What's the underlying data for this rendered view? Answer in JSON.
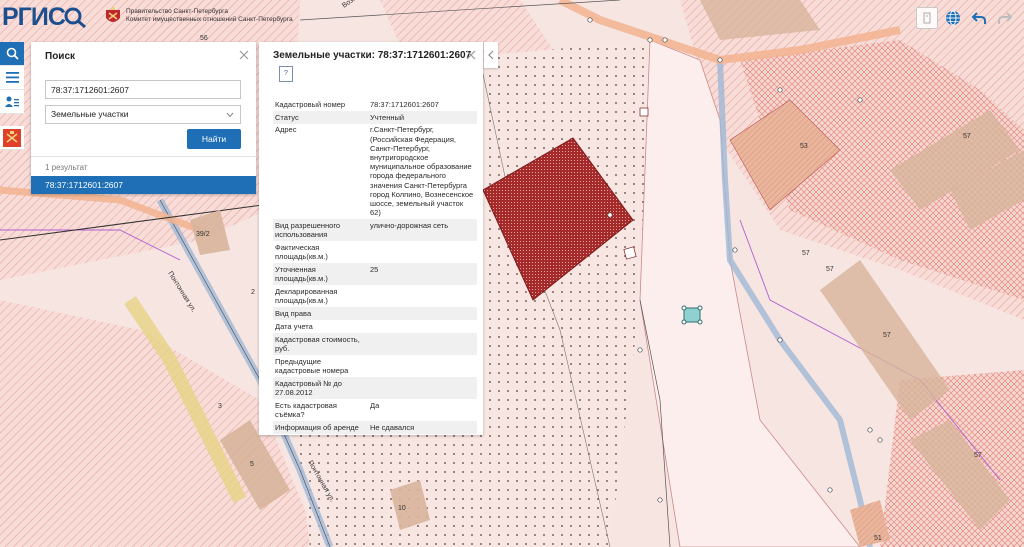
{
  "header": {
    "logo": "РГИС",
    "gov_line1": "Правительство Санкт-Петербурга",
    "gov_line2": "Комитет имущественных отношений Санкт-Петербурга"
  },
  "icons": {
    "search": "search-icon",
    "menu": "menu-icon",
    "user_list": "user-list-icon",
    "flag": "spb-flag-icon",
    "print": "print-icon",
    "globe": "globe-icon",
    "undo": "undo-icon",
    "redo": "redo-icon",
    "close": "close-icon",
    "chevron_left": "chevron-left-icon",
    "chevron_down": "chevron-down-icon"
  },
  "colors": {
    "accent": "#1e6fb5",
    "parcel": "#a52a2a",
    "map_bg": "#f6e4e1"
  },
  "search": {
    "title": "Поиск",
    "query": "78:37:1712601:2607",
    "type": "Земельные участки",
    "button": "Найти",
    "result_count": "1 результат",
    "results": [
      "78:37:1712601:2607"
    ]
  },
  "info": {
    "title": "Земельные участки: 78:37:1712601:2607",
    "help": "?",
    "rows": [
      {
        "key": "Кадастровый номер",
        "value": "78:37:1712601:2607"
      },
      {
        "key": "Статус",
        "value": "Учтенный"
      },
      {
        "key": "Адрес",
        "value": "г.Санкт-Петербург, (Российская Федерация, Санкт-Петербург, внутригородское муниципальное образование города федерального значения Санкт-Петербурга город Колпино, Вознесенское шоссе, земельный участок 62)"
      },
      {
        "key": "Вид разрешенного использования",
        "value": "улично-дорожная сеть"
      },
      {
        "key": "Фактическая площадь(кв.м.)",
        "value": ""
      },
      {
        "key": "Уточненная площадь(кв.м.)",
        "value": "25"
      },
      {
        "key": "Декларированная площадь(кв.м.)",
        "value": ""
      },
      {
        "key": "Вид права",
        "value": ""
      },
      {
        "key": "Дата учета",
        "value": ""
      },
      {
        "key": "Кадастровая стоимость, руб.",
        "value": ""
      },
      {
        "key": "Предыдущие кадастровые номера",
        "value": ""
      },
      {
        "key": "Кадастровый № до 27.08.2012",
        "value": ""
      },
      {
        "key": "Есть кадастровая съёмка?",
        "value": "Да"
      },
      {
        "key": "Информация об аренде",
        "value": "Не сдавался"
      }
    ]
  },
  "map": {
    "street_label_1": "Понтонная ул.",
    "street_label_2": "Вознесенское шоссе",
    "building_labels": [
      "56",
      "53",
      "57",
      "57",
      "57",
      "57",
      "57",
      "39/2",
      "3",
      "5",
      "10",
      "51",
      "2"
    ]
  }
}
